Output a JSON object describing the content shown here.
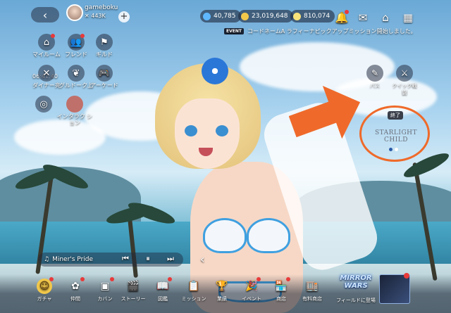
{
  "top": {
    "username": "gameboku",
    "user_count": "✕ 443K",
    "currency": [
      {
        "name": "gem",
        "value": "40,785",
        "color": "#5fb8ff"
      },
      {
        "name": "gold",
        "value": "23,019,648",
        "color": "#f2c84b"
      },
      {
        "name": "coin",
        "value": "810,074",
        "color": "#f7e27a"
      }
    ],
    "icons": [
      "notification-bell-icon",
      "mail-icon",
      "home-settings-icon",
      "grid-menu-icon"
    ]
  },
  "event": {
    "tag": "EVENT",
    "text": "コードネームA ラフィーナピックアップミッション開始しました。"
  },
  "left_menu": {
    "my_room": "マイルーム",
    "friends": "フレンド",
    "guild": "ギルド",
    "timer": "06:41:40",
    "dinner": "ダイナー亮",
    "gourmet": "グルドーク上",
    "arcade": "アーケード",
    "interaction": "インタラク ション"
  },
  "right_menu": {
    "pass": "パス",
    "quick_battle": "クイック戦闘"
  },
  "banner": {
    "ended": "終了",
    "title": "STARLIGHT CHILD"
  },
  "music": {
    "track": "Miner's Pride"
  },
  "bottom_nav": [
    {
      "id": "gacha",
      "label": "ガチャ",
      "icon": "gacha-icon",
      "badge": true
    },
    {
      "id": "companions",
      "label": "仲間",
      "icon": "companions-icon",
      "badge": true
    },
    {
      "id": "bag",
      "label": "カバン",
      "icon": "bag-icon",
      "badge": true
    },
    {
      "id": "story",
      "label": "ストーリー",
      "icon": "clapper-icon",
      "badge": false
    },
    {
      "id": "codex",
      "label": "図鑑",
      "icon": "book-icon",
      "badge": true
    },
    {
      "id": "missions",
      "label": "ミッション",
      "icon": "clipboard-icon",
      "badge": false
    },
    {
      "id": "achievements",
      "label": "業績",
      "icon": "trophy-icon",
      "badge": false
    },
    {
      "id": "events",
      "label": "イベント",
      "icon": "party-icon",
      "badge": true
    },
    {
      "id": "shop",
      "label": "商店",
      "icon": "store-icon",
      "badge": true
    },
    {
      "id": "paid_shop",
      "label": "有料商店",
      "icon": "paid-store-icon",
      "badge": false
    }
  ],
  "mirror_wars": {
    "title_line1": "MIRROR",
    "title_line2": "WARS",
    "label": "フィールドに登場"
  }
}
